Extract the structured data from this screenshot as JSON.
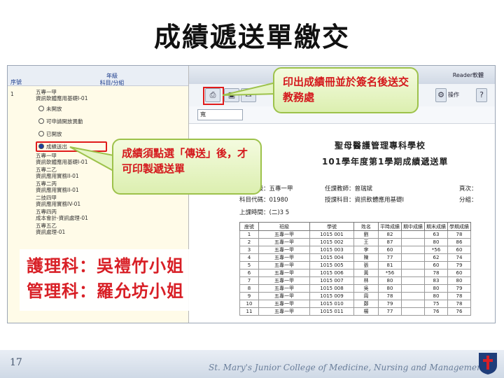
{
  "slide": {
    "title": "成績遞送單繳交",
    "page_number": "17",
    "footer": "St. Mary's Junior College of Medicine, Nursing and Management"
  },
  "left_panel": {
    "header": {
      "col1": "序號",
      "col2_line1": "年級",
      "col2_line2": "科目/分組"
    },
    "rows": [
      {
        "text": "1",
        "y": 0
      },
      {
        "text": "五專一甲",
        "y": 0
      },
      {
        "text": "資訊軟體應用基礎I-01",
        "y": 0
      }
    ],
    "group1_num": "1",
    "group1_class": "五專一甲",
    "group1_subject": "資訊軟體應用基礎I-01",
    "radios": [
      "未開放",
      "可申請開放異動",
      "已開放",
      "成績送出"
    ],
    "radio_selected": "成績送出",
    "other_rows": [
      "五專一甲",
      "資訊軟體應用基礎I-01",
      "五專二乙",
      "資訊應用實務II-01",
      "五專二丙",
      "資訊應用實務II-01",
      "二技四甲",
      "資訊應用實務IV-01",
      "五專四丙",
      "成本會計-資訊處理-01",
      "五專五乙",
      "資訊處理-01"
    ]
  },
  "toolbar": {
    "print_icon": "printer-icon",
    "save_icon": "save-icon",
    "mail_icon": "mail-icon",
    "operation_label": "操作",
    "top_right_text": "Reader軟體",
    "zoom_value": "寬"
  },
  "document": {
    "school": "聖母醫護管理專科學校",
    "subtitle": "101學年度第1學期成績遞送單",
    "class_label": "開課班級：五專一甲",
    "subject_code": "科目代碼：01980",
    "class_time": "上課時間：(二)3 5",
    "teacher": "任課教師：曾瑞斌",
    "subject_name": "授課科目：資訊軟體應用基礎I",
    "page_label": "頁次：",
    "group_label": "分組：",
    "table_headers": [
      "座號",
      "班級",
      "學號",
      "姓名",
      "平時成績",
      "期中成績",
      "期末成績",
      "學期成績"
    ],
    "rows": [
      [
        "1",
        "五專一甲",
        "1015",
        "001",
        "劉",
        "82",
        "63",
        "78"
      ],
      [
        "2",
        "五專一甲",
        "1015",
        "002",
        "王",
        "87",
        "80",
        "86"
      ],
      [
        "3",
        "五專一甲",
        "1015",
        "003",
        "李",
        "60",
        "*56",
        "60"
      ],
      [
        "4",
        "五專一甲",
        "1015",
        "004",
        "陳",
        "77",
        "62",
        "74"
      ],
      [
        "5",
        "五專一甲",
        "1015",
        "005",
        "張",
        "81",
        "60",
        "79"
      ],
      [
        "6",
        "五專一甲",
        "1015",
        "006",
        "黃",
        "*56",
        "78",
        "60"
      ],
      [
        "7",
        "五專一甲",
        "1015",
        "007",
        "林",
        "80",
        "83",
        "80"
      ],
      [
        "8",
        "五專一甲",
        "1015",
        "008",
        "吳",
        "80",
        "80",
        "79"
      ],
      [
        "9",
        "五專一甲",
        "1015",
        "009",
        "周",
        "78",
        "80",
        "78"
      ],
      [
        "10",
        "五專一甲",
        "1015",
        "010",
        "鄭",
        "79",
        "75",
        "78"
      ],
      [
        "11",
        "五專一甲",
        "1015",
        "011",
        "楊",
        "77",
        "76",
        "76"
      ]
    ]
  },
  "callouts": {
    "print_note": "印出成績冊並於簽名後送交教務處",
    "send_note": "成績須點選「傳送」後，才可印製遞送單"
  },
  "contacts": {
    "line1": "護理科：吳禮竹小姐",
    "line2": "管理科：羅允坊小姐"
  }
}
